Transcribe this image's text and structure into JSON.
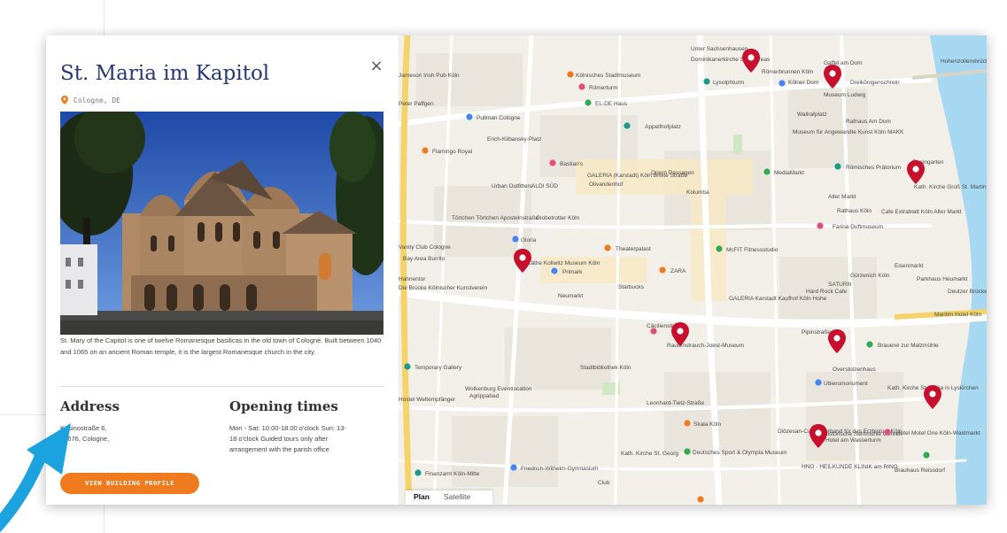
{
  "title": "St. Maria im Kapitol",
  "location": "Cologne, DE",
  "close_label": "×",
  "description": "St. Mary of the Capitol is one of twelve Romanesque basilicas in the old town of Cologne. Built between 1040 and 1065 on an ancient Roman temple, it is the largest Romanesque church in the city.",
  "address": {
    "heading": "Address",
    "line1": "Kasinostraße 6,",
    "line2": "50676, Cologne,"
  },
  "opening": {
    "heading": "Opening times",
    "line1": "Mon - Sat: 10.00-18.00 o'clock Sun: 13-",
    "line2": "18 o'clock Guided tours only after",
    "line3": "arrangement with the parish office"
  },
  "button_label": "VIEW BUILDING PROFILE",
  "map": {
    "tabs": [
      "Plan",
      "Satellite"
    ],
    "active_tab": "Plan",
    "labels": [
      "Unter Sachsenhausen",
      "Dominikanerkirche St. Andreas",
      "Gaffel am Dom",
      "Hohenzollernbrücke",
      "Römerbrunnen Köln",
      "Jameson Irish Pub Köln",
      "Kölnisches Stadtmuseum",
      "Römerturm",
      "Lysolphturm",
      "Kölner Dom",
      "Dreikönigenschrein",
      "Museum Ludwig",
      "Rathaus Am Dom",
      "Peter Paffgen",
      "EL-DE Haus",
      "Appellhofplatz",
      "Pullman Cologne",
      "Wallrafplatz",
      "Museum für Angewandte Kunst Köln MAKK",
      "Erich-Klibansky-Platz",
      "Flamingo Royal",
      "Bastian's",
      "MediaMarkt",
      "Römisches Prätorium",
      "Rheingarten",
      "Urban Outfitters",
      "GALERIA (Karstadt) Köln Breite Straße",
      "Olivandenhof",
      "Opern Passagen",
      "ALDI SÜD",
      "Kolumba",
      "Alter Markt",
      "Kath. Kirche Groß St. Martin",
      "Rathaus Köln",
      "Cafe Extrablatt Köln Alter Markt",
      "Törtchen Törtchen Apostelnstraße",
      "Globetrotter Köln",
      "Farina Duftmuseum",
      "Vanity Club Cologne",
      "Gloria",
      "Theaterpalast",
      "Bay Area Burrito",
      "McFIT Fitnessstudio",
      "Eisenmarkt",
      "Käthe Kollwitz Museum Köln",
      "Primark",
      "ZARA",
      "Gürzenich Köln",
      "SATURN",
      "Hard Rock Cafe",
      "Parkhaus Heumarkt",
      "Deutzer Brücke",
      "Hahnentor",
      "Die Brücke Kölnischer Kunstverein",
      "Starbucks",
      "Neumarkt",
      "GALERIA Karstadt Kaufhof Köln Hohe",
      "Maritim Hotel Köln",
      "Cäcilienstraße",
      "Pipinstraße",
      "Rautenstrauch-Joest-Museum",
      "Brauerei zur Malzmühle",
      "Temporary Gallery",
      "Stadtbibliothek Köln",
      "Overstolzenhaus",
      "Ubierumonument",
      "Kath. Kirche St. Maria in Lyskirchen",
      "Leonhard-Tietz-Straße",
      "Hostel Weltempfänger",
      "Wolkenburg Eventlocation",
      "Agrippabad",
      "Skala Köln",
      "Diözesan-Caritasverband für das Erzbistum Köln",
      "Historische Senfmühle Gehren",
      "Hotel am Wasserturm",
      "Hotel Motel One Köln-Waidmarkt",
      "Kath. Kirche St. Georg",
      "Deutsches Sport & Olympia Museum",
      "HNO - HEILKUNDE KLINIK am RING",
      "Brauhaus Reissdorf",
      "Finanzamt Köln-Mitte",
      "Friedrich-Wilhelm-Gymnasium",
      "Club"
    ]
  },
  "colors": {
    "title": "#253775",
    "accent": "#f07a1e",
    "pin": "#c8102e",
    "arrow": "#1aa3df",
    "river": "#a6d8f2"
  }
}
